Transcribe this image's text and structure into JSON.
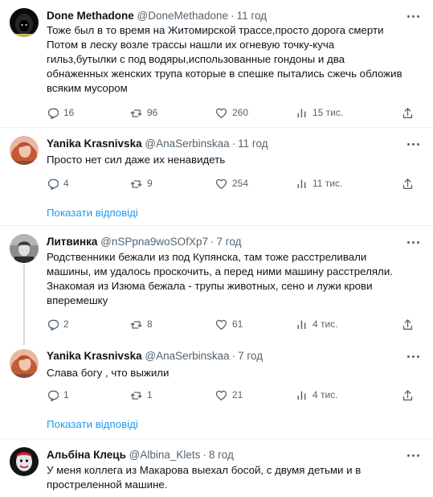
{
  "tweets": [
    {
      "name": "Done Methadone",
      "handle": "@DoneMethadone",
      "separator": "·",
      "time": "11 год",
      "lines": [
        "Тоже был в то время на Житомирской трассе,просто дорога смерти",
        "Потом в леску возле трассы нашли их огневую точку-куча",
        "гильз,бутылки с под водяры,использованные гондоны и два",
        "обнаженных женских трупа которые в спешке пытались сжечь обложив",
        "всяким мусором"
      ],
      "replies": "16",
      "retweets": "96",
      "likes": "260",
      "views": "15 тис."
    },
    {
      "name": "Yanika Krasnivska",
      "handle": "@AnaSerbinskaa",
      "separator": "·",
      "time": "11 год",
      "lines": [
        "Просто нет сил даже их ненавидеть"
      ],
      "replies": "4",
      "retweets": "9",
      "likes": "254",
      "views": "11 тис."
    },
    {
      "name": "Литвинка",
      "handle": "@nSPpna9woSOfXp7",
      "separator": "·",
      "time": "7 год",
      "lines": [
        "Родственники бежали из под Купянска, там тоже расстреливали",
        "машины, им удалось проскочить, а перед ними машину расстреляли.",
        "Знакомая из Изюма бежала - трупы животных, сено и лужи крови",
        "вперемешку"
      ],
      "replies": "2",
      "retweets": "8",
      "likes": "61",
      "views": "4 тис."
    },
    {
      "name": "Yanika Krasnivska",
      "handle": "@AnaSerbinskaa",
      "separator": "·",
      "time": "7 год",
      "lines": [
        "Слава богу , что выжили"
      ],
      "replies": "1",
      "retweets": "1",
      "likes": "21",
      "views": "4 тис."
    },
    {
      "name": "Альбіна Клець",
      "handle": "@Albina_Klets",
      "separator": "·",
      "time": "8 год",
      "lines": [
        "У меня коллега из Макарова выехал босой, с двумя детьми и в",
        "простреленной машине."
      ]
    }
  ],
  "show_replies_label": "Показати відповіді",
  "colors": {
    "text": "#0f1419",
    "secondary": "#536471",
    "link": "#1d9bf0",
    "divider": "#eff3f4",
    "thread": "#cfd9de"
  },
  "icons": [
    "reply-icon",
    "retweet-icon",
    "like-icon",
    "views-icon",
    "share-icon",
    "more-icon"
  ]
}
